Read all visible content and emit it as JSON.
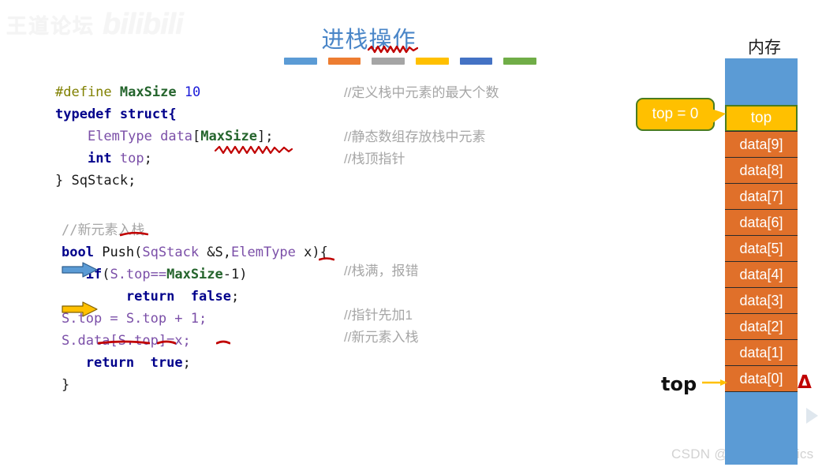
{
  "watermarks": {
    "top_left_cn": "王道论坛",
    "top_left_brand": "bilibili",
    "bottom_right": "CSDN @xMathematics"
  },
  "title": {
    "text": "进栈操作"
  },
  "accent_bars": [
    {
      "name": "bar-light-blue",
      "color": "#5b9bd5"
    },
    {
      "name": "bar-orange",
      "color": "#ed7d31"
    },
    {
      "name": "bar-gray",
      "color": "#a5a5a5"
    },
    {
      "name": "bar-yellow",
      "color": "#ffc000"
    },
    {
      "name": "bar-blue",
      "color": "#4472c4"
    },
    {
      "name": "bar-green",
      "color": "#70ad47"
    }
  ],
  "code": {
    "struct_block": {
      "line1": {
        "kw": "#define",
        "name": "MaxSize",
        "value": "10"
      },
      "line2": {
        "kw1": "typedef",
        "kw2": "struct{"
      },
      "line3": {
        "type": "ElemType",
        "var": "data",
        "open": "[",
        "size": "MaxSize",
        "close": "];"
      },
      "line4": {
        "kw": "int",
        "var": "top",
        "semi": ";"
      },
      "line5": {
        "text": "} SqStack;"
      }
    },
    "push_block": {
      "comment": "//新元素入栈",
      "signature": {
        "ret": "bool",
        "fn": "Push",
        "open": "(",
        "t1": "SqStack",
        "a1": " &S,",
        "t2": "ElemType",
        "a2": " x){"
      },
      "if_line": {
        "kw": "if",
        "open": "(",
        "expr": "S.top==",
        "cnst": "MaxSize",
        "tail": "-1)"
      },
      "return_false": {
        "kw": "return",
        "val": "false",
        "semi": ";"
      },
      "incr_line": "S.top = S.top + 1;",
      "assign_line": "S.data[S.top]=x;",
      "return_true": {
        "kw": "return",
        "val": "true",
        "semi": ";"
      },
      "close_brace": "}"
    }
  },
  "comments_struct": {
    "c1": "//定义栈中元素的最大个数",
    "c2": "//静态数组存放栈中元素",
    "c3": "//栈顶指针"
  },
  "comments_push": {
    "c1": "//栈满，报错",
    "c2": "//指针先加1",
    "c3": "//新元素入栈"
  },
  "memory": {
    "label": "内存",
    "callout": "top = 0",
    "top_cell": "top",
    "cells": [
      "data[9]",
      "data[8]",
      "data[7]",
      "data[6]",
      "data[5]",
      "data[4]",
      "data[3]",
      "data[2]",
      "data[1]",
      "data[0]"
    ],
    "bottom_pointer_label": "top",
    "delta_marker": "Δ",
    "colors": {
      "free_memory": "#5b9bd5",
      "top_cell": "#ffc000",
      "top_cell_border": "#4a7c1f",
      "data_cell": "#e0702a"
    }
  },
  "arrows": {
    "blue_arrow_color": "#5b9bd5",
    "yellow_arrow_color": "#ffc000",
    "pointer_arrow_color": "#ffc000"
  }
}
